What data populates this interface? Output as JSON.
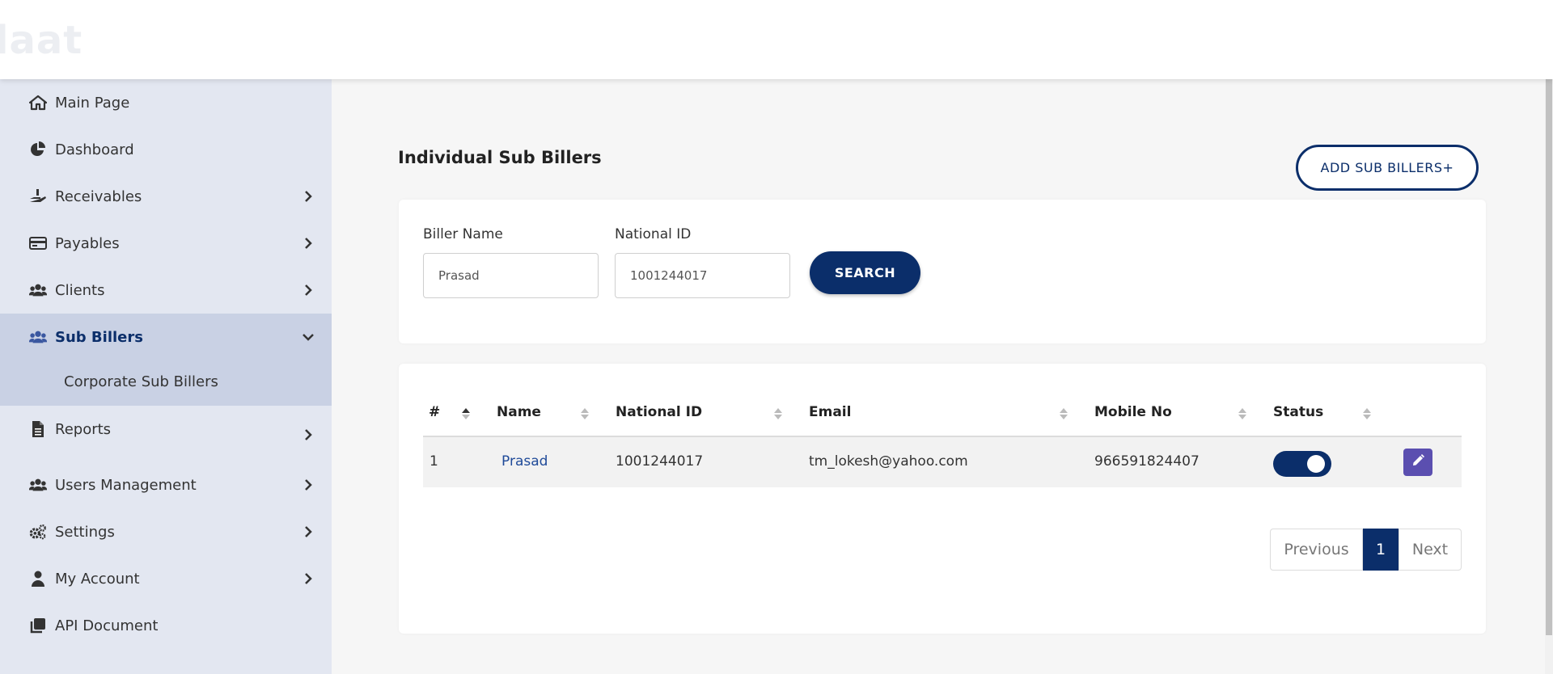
{
  "brand": {
    "logo_text": "laat"
  },
  "sidebar": {
    "items": [
      {
        "label": "Main Page",
        "icon": "home-icon"
      },
      {
        "label": "Dashboard",
        "icon": "pie-chart-icon"
      },
      {
        "label": "Receivables",
        "icon": "hand-money-icon"
      },
      {
        "label": "Payables",
        "icon": "credit-card-icon"
      },
      {
        "label": "Clients",
        "icon": "users-icon"
      },
      {
        "label": "Sub Billers",
        "icon": "users-icon",
        "active": true
      },
      {
        "label": "Reports",
        "icon": "file-icon"
      },
      {
        "label": "Users Management",
        "icon": "users-icon"
      },
      {
        "label": "Settings",
        "icon": "gears-icon"
      },
      {
        "label": "My Account",
        "icon": "user-icon"
      },
      {
        "label": "API Document",
        "icon": "copy-icon"
      }
    ],
    "sub_items": [
      {
        "label": "Corporate Sub Billers"
      }
    ]
  },
  "page": {
    "title": "Individual Sub Billers",
    "add_button": "ADD SUB BILLERS+"
  },
  "search": {
    "biller_name_label": "Biller Name",
    "biller_name_value": "Prasad",
    "national_id_label": "National ID",
    "national_id_value": "1001244017",
    "button": "SEARCH"
  },
  "table": {
    "columns": [
      "#",
      "Name",
      "National ID",
      "Email",
      "Mobile No",
      "Status"
    ],
    "rows": [
      {
        "index": "1",
        "name": "Prasad",
        "national_id": "1001244017",
        "email": "tm_lokesh@yahoo.com",
        "mobile": "966591824407",
        "status_on": true
      }
    ]
  },
  "pagination": {
    "previous": "Previous",
    "current": "1",
    "next": "Next"
  },
  "colors": {
    "primary": "#0b2e6a",
    "sidebar_bg": "#e3e7f1",
    "sidebar_active": "#c9d1e4",
    "edit_button": "#5b4fb0"
  }
}
